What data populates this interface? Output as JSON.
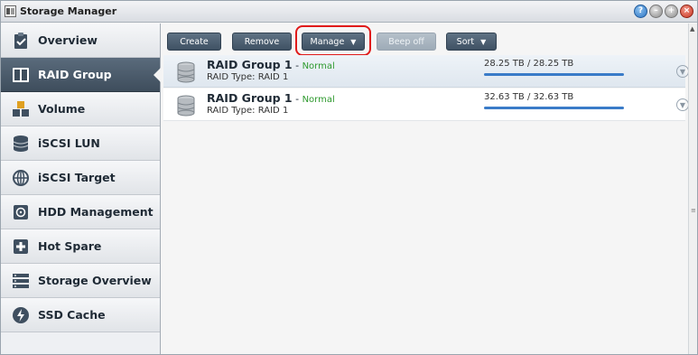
{
  "window": {
    "title": "Storage Manager",
    "buttons": [
      "help",
      "minimize",
      "maximize",
      "close"
    ]
  },
  "sidebar": {
    "items": [
      {
        "label": "Overview",
        "icon": "clipboard-icon",
        "active": false
      },
      {
        "label": "RAID Group",
        "icon": "raid-group-icon",
        "active": true
      },
      {
        "label": "Volume",
        "icon": "volume-icon",
        "active": false
      },
      {
        "label": "iSCSI LUN",
        "icon": "database-icon",
        "active": false
      },
      {
        "label": "iSCSI Target",
        "icon": "globe-icon",
        "active": false
      },
      {
        "label": "HDD Management",
        "icon": "hdd-icon",
        "active": false
      },
      {
        "label": "Hot Spare",
        "icon": "hot-spare-icon",
        "active": false
      },
      {
        "label": "Storage Overview",
        "icon": "storage-overview-icon",
        "active": false
      },
      {
        "label": "SSD Cache",
        "icon": "lightning-icon",
        "active": false
      }
    ]
  },
  "toolbar": {
    "create_label": "Create",
    "remove_label": "Remove",
    "manage_label": "Manage",
    "beep_off_label": "Beep off",
    "sort_label": "Sort"
  },
  "raid_groups": [
    {
      "name": "RAID Group 1",
      "separator": " - ",
      "status": "Normal",
      "type": "RAID Type: RAID 1",
      "capacity": "28.25 TB / 28.25 TB",
      "used_fraction": 1.0
    },
    {
      "name": "RAID Group 1",
      "separator": " - ",
      "status": "Normal",
      "type": "RAID Type: RAID 1",
      "capacity": "32.63 TB / 32.63 TB",
      "used_fraction": 1.0
    }
  ],
  "colors": {
    "active_nav": "#4a5a6a",
    "status_normal": "#2f9a2f",
    "progress": "#3a7bc8",
    "highlight": "#e01a1a"
  }
}
